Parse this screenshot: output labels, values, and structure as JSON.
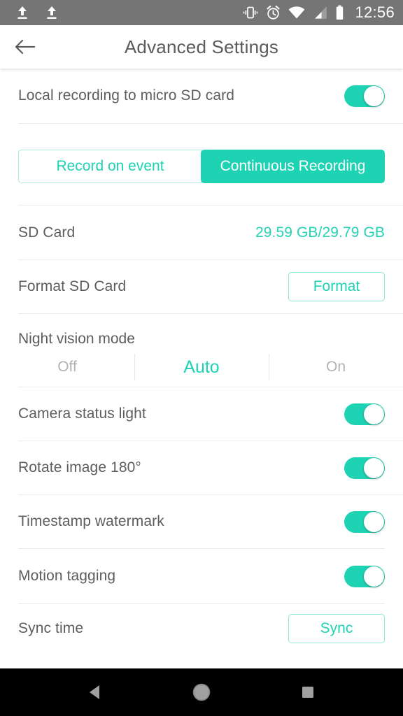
{
  "status_bar": {
    "icons": [
      "upload-icon",
      "upload-icon",
      "vibrate-icon",
      "alarm-icon",
      "wifi-icon",
      "signal-icon",
      "battery-icon"
    ],
    "time": "12:56",
    "background_color": "#757575"
  },
  "toolbar": {
    "back_icon": "back-arrow-icon",
    "title": "Advanced Settings"
  },
  "theme": {
    "accent": "#1ed3b4",
    "label_color": "#5d5d5d",
    "muted_color": "#b2b2b2",
    "divider_color": "#ececec"
  },
  "settings": {
    "local_recording": {
      "label": "Local recording to micro SD card",
      "toggle_on": true
    },
    "recording_mode": {
      "options": [
        "Record on event",
        "Continuous Recording"
      ],
      "selected_index": 1
    },
    "sd_card": {
      "label": "SD Card",
      "value": "29.59 GB/29.79 GB"
    },
    "format_sd_card": {
      "label": "Format SD Card",
      "button_label": "Format"
    },
    "night_vision": {
      "label": "Night vision mode",
      "options": [
        "Off",
        "Auto",
        "On"
      ],
      "selected_index": 1
    },
    "camera_status_light": {
      "label": "Camera status light",
      "toggle_on": true
    },
    "rotate_image": {
      "label": "Rotate image 180°",
      "toggle_on": true
    },
    "timestamp_watermark": {
      "label": "Timestamp watermark",
      "toggle_on": true
    },
    "motion_tagging": {
      "label": "Motion tagging",
      "toggle_on": true
    },
    "sync_time": {
      "label": "Sync time",
      "button_label": "Sync"
    }
  },
  "navbar": {
    "back_icon": "nav-back-triangle-icon",
    "home_icon": "nav-home-circle-icon",
    "recents_icon": "nav-recents-square-icon"
  }
}
